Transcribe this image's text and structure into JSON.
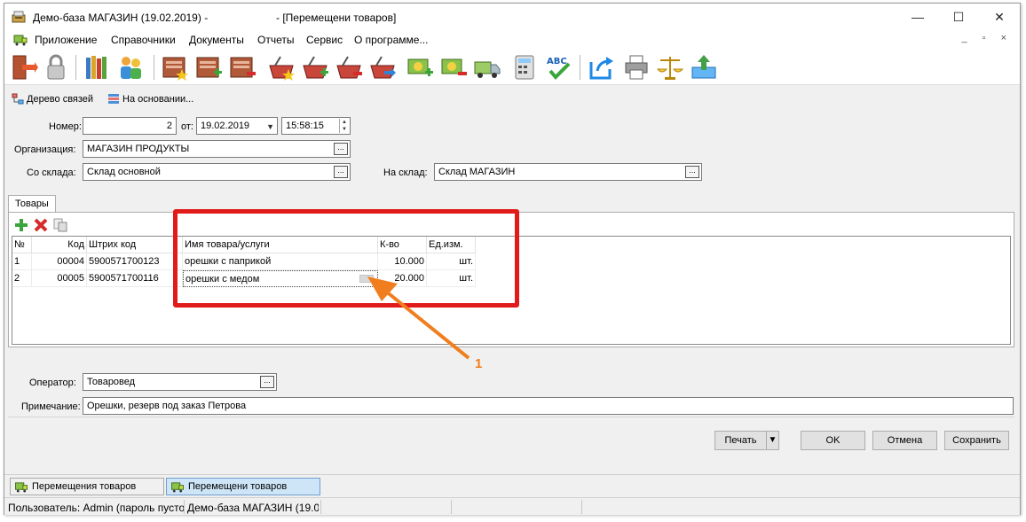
{
  "window": {
    "title_app": "Демо-база МАГАЗИН (19.02.2019) -",
    "title_doc": "- [Перемещени товаров]",
    "minimize": "—",
    "maximize": "☐",
    "close": "✕"
  },
  "menu": {
    "items": [
      "Приложение",
      "Справочники",
      "Документы",
      "Отчеты",
      "Сервис",
      "О программе..."
    ],
    "mdi_buttons": "_ ▫ ×"
  },
  "links": {
    "tree": "Дерево связей",
    "based_on": "На основании..."
  },
  "form": {
    "number_label": "Номер:",
    "number_value": "2",
    "from_label": "от:",
    "date_value": "19.02.2019",
    "time_value": "15:58:15",
    "org_label": "Организация:",
    "org_value": "МАГАЗИН ПРОДУКТЫ",
    "from_wh_label": "Со склада:",
    "from_wh_value": "Склад основной",
    "to_wh_label": "На склад:",
    "to_wh_value": "Склад МАГАЗИН",
    "operator_label": "Оператор:",
    "operator_value": "Товаровед",
    "note_label": "Примечание:",
    "note_value": "Орешки, резерв под заказ Петрова"
  },
  "tabs": [
    "Товары"
  ],
  "grid": {
    "headers": [
      "№",
      "Код",
      "Штрих код",
      "Имя товара/услуги",
      "К-во",
      "Ед.изм."
    ],
    "rows": [
      {
        "n": "1",
        "code": "00004",
        "barcode": "5900571700123",
        "name": "орешки с паприкой",
        "qty": "10.000",
        "unit": "шт."
      },
      {
        "n": "2",
        "code": "00005",
        "barcode": "5900571700116",
        "name": "орешки с медом",
        "qty": "20.000",
        "unit": "шт."
      }
    ]
  },
  "annotation": {
    "callout": "1",
    "color": "#e11a1a",
    "arrow_color": "#f07e1e"
  },
  "buttons": {
    "print": "Печать",
    "ok": "OK",
    "cancel": "Отмена",
    "save": "Сохранить"
  },
  "window_tabs": [
    {
      "label": "Перемещения товаров",
      "active": false
    },
    {
      "label": "Перемещени товаров",
      "active": true
    }
  ],
  "status": {
    "user": "Пользователь: Admin (пароль пусто",
    "base": "Демо-база МАГАЗИН (19.0"
  }
}
